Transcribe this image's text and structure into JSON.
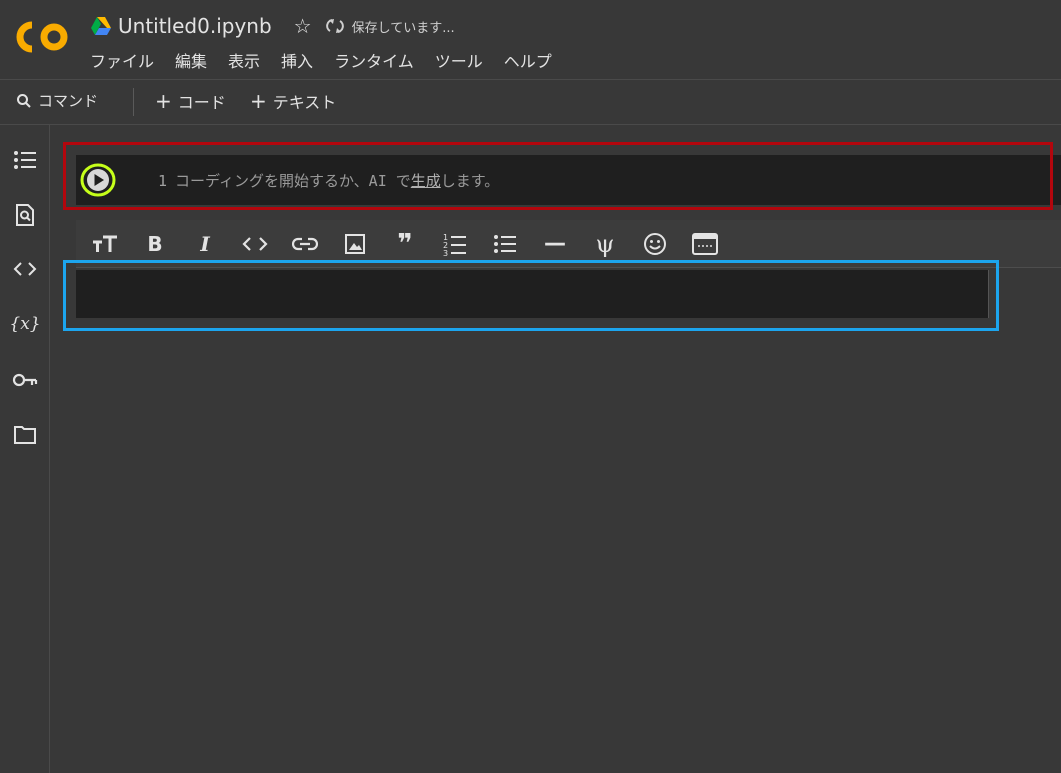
{
  "header": {
    "title": "Untitled0.ipynb",
    "save_status": "保存しています...",
    "menu": [
      "ファイル",
      "編集",
      "表示",
      "挿入",
      "ランタイム",
      "ツール",
      "ヘルプ"
    ]
  },
  "toolbar": {
    "command_label": "コマンド",
    "add_code_label": "コード",
    "add_text_label": "テキスト"
  },
  "code_cell": {
    "line_number": "1",
    "placeholder_before": "コーディングを開始するか、AI で",
    "placeholder_link": "生成",
    "placeholder_after": "します。"
  },
  "sidebar": {
    "icons": [
      "table-of-contents-icon",
      "find-icon",
      "code-snippets-icon",
      "variables-icon",
      "secrets-key-icon",
      "files-folder-icon"
    ],
    "variables_label": "{x}"
  },
  "text_toolbar": {
    "bold_label": "B",
    "italic_label": "I",
    "quote_label": "❞",
    "rule_label": "—",
    "psi_label": "ψ"
  },
  "colors": {
    "background": "#383838",
    "cell": "#1f1f1f",
    "highlight_red": "#b3060d",
    "highlight_blue": "#1ca5ee",
    "highlight_green": "#c6ff1a",
    "logo_orange": "#f9ab00"
  }
}
